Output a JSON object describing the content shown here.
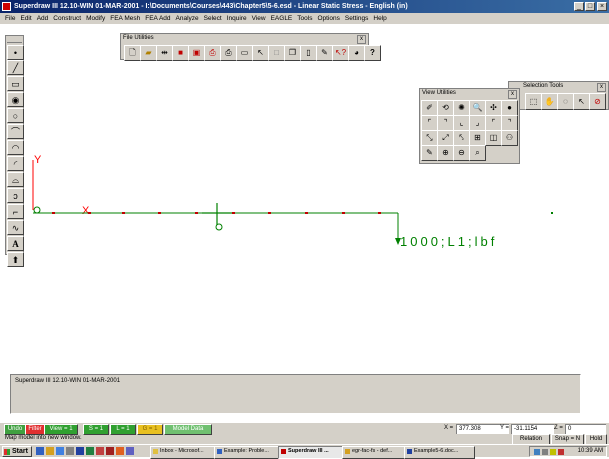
{
  "window": {
    "title": "Superdraw III 12.10-WIN 01-MAR-2001 - I:\\Documents\\Courses\\443\\Chapter5\\5-6.esd - Linear Static Stress - English (in)"
  },
  "menu": [
    "File",
    "Edit",
    "Add",
    "Construct",
    "Modify",
    "FEA Mesh",
    "FEA Add",
    "Analyze",
    "Select",
    "Inquire",
    "View",
    "EAGLE",
    "Tools",
    "Options",
    "Settings",
    "Help"
  ],
  "panels": {
    "file_utilities": {
      "title": "File Utilities",
      "close": "x"
    },
    "view_utilities": {
      "title": "View Utilities",
      "close": "x"
    },
    "selection_tools": {
      "title": "Selection Tools",
      "close": "x"
    }
  },
  "drawing": {
    "axis_y_label": "Y",
    "axis_x_label": "X",
    "load_label": "1000;L1;lbf",
    "line_color": "#008000",
    "axis_color": "#ff0000"
  },
  "message_area": {
    "text": "Superdraw III 12.10-WIN 01-MAR-2001"
  },
  "status": {
    "buttons": {
      "undo": "Undo",
      "filter": "Filter",
      "view": "View = 1",
      "s": "S = 1",
      "l": "L = 1",
      "g": "G = 1",
      "model_data": "Model Data"
    },
    "hint": "Map model into new window.",
    "coords": {
      "x_label": "X =",
      "x_value": "377.308",
      "y_label": "Y =",
      "y_value": "-31.1154",
      "z_label": "Z =",
      "z_value": "0"
    },
    "relation": "Relation",
    "snap": "Snap = N",
    "hold": "Hold"
  },
  "taskbar": {
    "start": "Start",
    "tasks": [
      "Inbox - Microsof...",
      "Example: Proble...",
      "Superdraw III ...",
      "egr-fac-fs - def...",
      "Example5-6.doc..."
    ],
    "clock": "10:39 AM"
  }
}
